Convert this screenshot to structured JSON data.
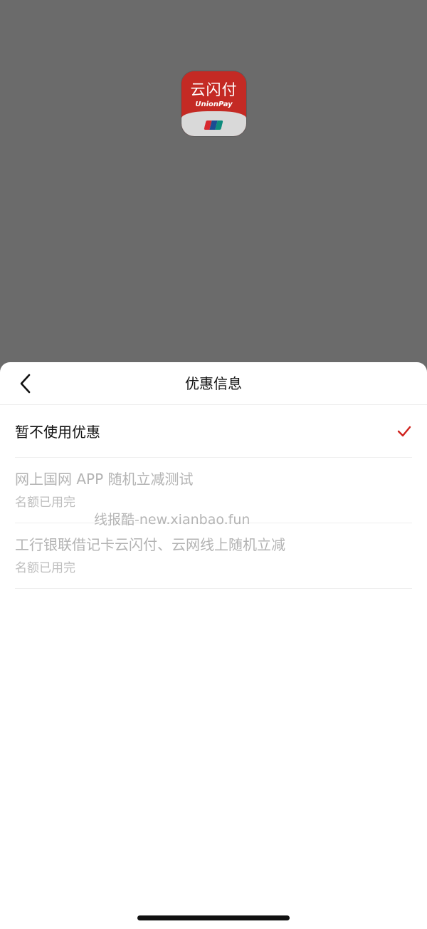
{
  "app_icon": {
    "name": "云闪付",
    "brand": "UnionPay",
    "bg_color": "#c42a24",
    "logo_colors": [
      "#d7282f",
      "#1b4c93",
      "#0e8b7d"
    ]
  },
  "sheet": {
    "title": "优惠信息",
    "back_icon": "chevron-left-icon"
  },
  "options": [
    {
      "title": "暂不使用优惠",
      "selected": true,
      "check_icon": "checkmark-icon",
      "check_color": "#d0211c"
    },
    {
      "title": "网上国网 APP 随机立减测试",
      "subtitle": "名额已用完",
      "disabled": true
    },
    {
      "title": "工行银联借记卡云闪付、云网线上随机立减",
      "subtitle": "名额已用完",
      "disabled": true
    }
  ],
  "watermark": "线报酷-new.xianbao.fun"
}
